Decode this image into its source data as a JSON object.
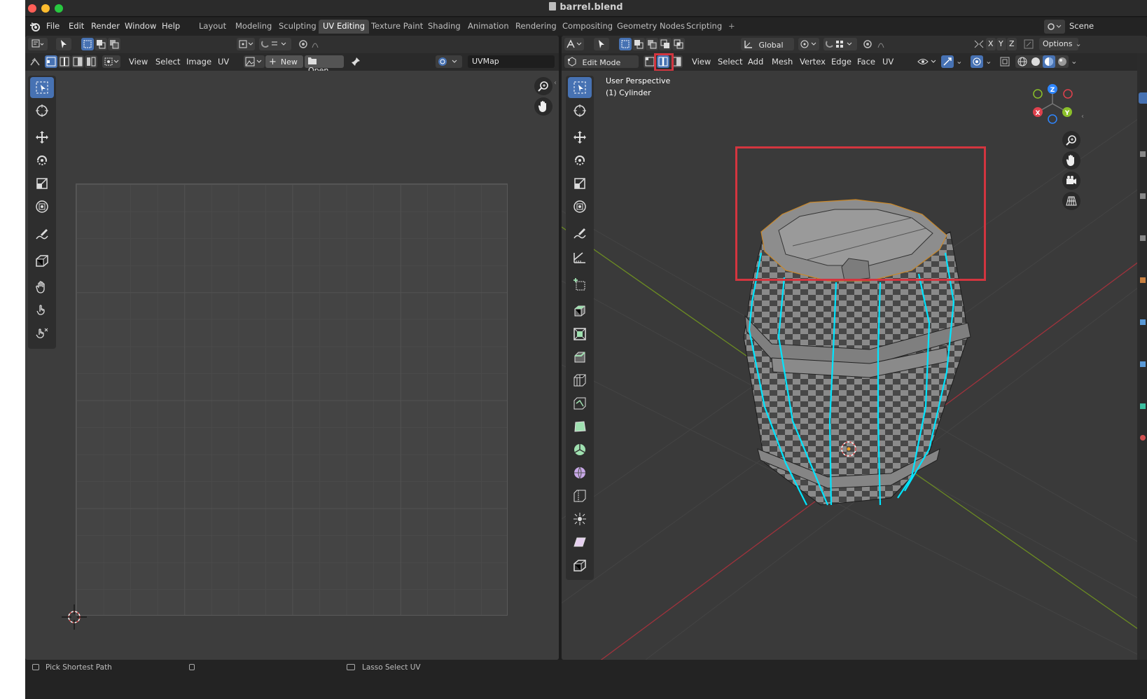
{
  "window": {
    "title": "barrel.blend"
  },
  "traffic_lights": {
    "close": "#ff5f57",
    "minimize": "#febc2e",
    "maximize": "#28c840"
  },
  "menu": [
    "File",
    "Edit",
    "Render",
    "Window",
    "Help"
  ],
  "workspace_tabs": [
    {
      "label": "Layout",
      "active": false
    },
    {
      "label": "Modeling",
      "active": false
    },
    {
      "label": "Sculpting",
      "active": false
    },
    {
      "label": "UV Editing",
      "active": true
    },
    {
      "label": "Texture Paint",
      "active": false
    },
    {
      "label": "Shading",
      "active": false
    },
    {
      "label": "Animation",
      "active": false
    },
    {
      "label": "Rendering",
      "active": false
    },
    {
      "label": "Compositing",
      "active": false
    },
    {
      "label": "Geometry Nodes",
      "active": false
    },
    {
      "label": "Scripting",
      "active": false
    }
  ],
  "add_workspace": "+",
  "scene": {
    "label": "Scene"
  },
  "uv_editor": {
    "menus": [
      "View",
      "Select",
      "Image",
      "UV"
    ],
    "new_button": "New",
    "open_button": "Open",
    "uvmap_field": "UVMap"
  },
  "viewport": {
    "mode": "Edit Mode",
    "menus": [
      "View",
      "Select",
      "Add",
      "Mesh",
      "Vertex",
      "Edge",
      "Face",
      "UV"
    ],
    "transform_orientation": "Global",
    "options": "Options",
    "axis_buttons": [
      "X",
      "Y",
      "Z"
    ],
    "overlay_line1": "User Perspective",
    "overlay_line2": "(1) Cylinder",
    "gizmo_labels": [
      "Z",
      "X",
      "Y"
    ]
  },
  "status": {
    "left": "Pick Shortest Path",
    "middle": "Lasso Select UV"
  },
  "colors": {
    "accent": "#4772b3",
    "highlight_red": "#d3353f",
    "seam_cyan": "#00e5ff",
    "axis_x": "#e0414d",
    "axis_y": "#8bbf2a",
    "axis_z": "#2e86ff"
  }
}
